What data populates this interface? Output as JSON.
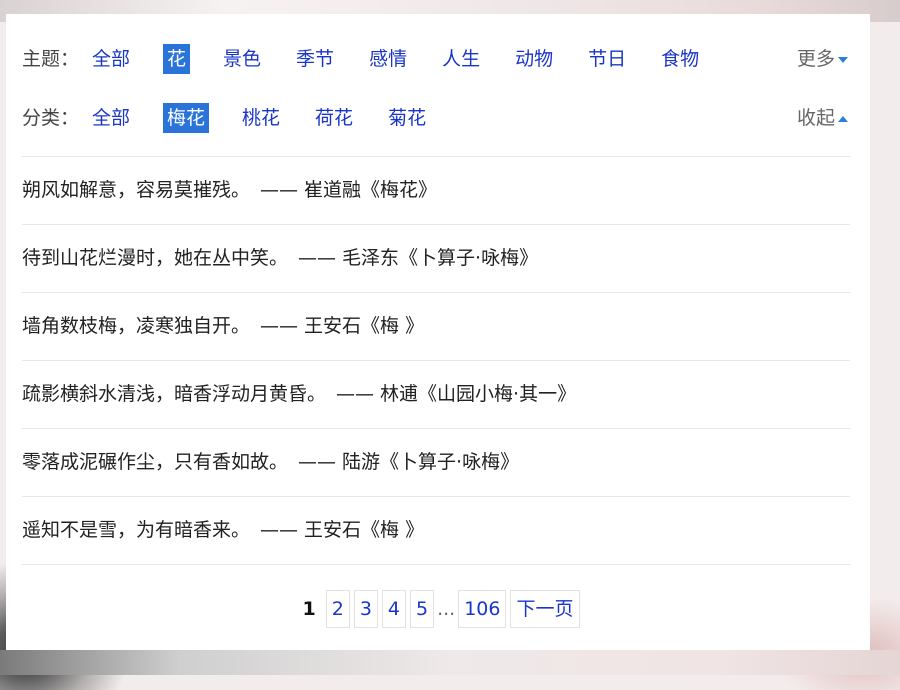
{
  "filters": {
    "theme": {
      "label": "主题：",
      "items": [
        "全部",
        "花",
        "景色",
        "季节",
        "感情",
        "人生",
        "动物",
        "节日",
        "食物"
      ],
      "active_index": 1,
      "toggle_label": "更多"
    },
    "category": {
      "label": "分类：",
      "items": [
        "全部",
        "梅花",
        "桃花",
        "荷花",
        "菊花"
      ],
      "active_index": 1,
      "toggle_label": "收起"
    }
  },
  "poems": [
    {
      "line": "朔风如解意，容易莫摧残。",
      "dash": "——",
      "author": "崔道融",
      "title": "《梅花》"
    },
    {
      "line": "待到山花烂漫时，她在丛中笑。",
      "dash": "——",
      "author": "毛泽东",
      "title": "《卜算子·咏梅》"
    },
    {
      "line": "墙角数枝梅，凌寒独自开。",
      "dash": "——",
      "author": "王安石",
      "title": "《梅 》"
    },
    {
      "line": "疏影横斜水清浅，暗香浮动月黄昏。",
      "dash": "——",
      "author": "林逋",
      "title": "《山园小梅·其一》"
    },
    {
      "line": "零落成泥碾作尘，只有香如故。",
      "dash": "——",
      "author": "陆游",
      "title": "《卜算子·咏梅》"
    },
    {
      "line": "遥知不是雪，为有暗香来。",
      "dash": "——",
      "author": "王安石",
      "title": "《梅 》"
    }
  ],
  "pagination": {
    "current": "1",
    "pages": [
      "2",
      "3",
      "4",
      "5"
    ],
    "ellipsis": "...",
    "last": "106",
    "next_label": "下一页"
  }
}
